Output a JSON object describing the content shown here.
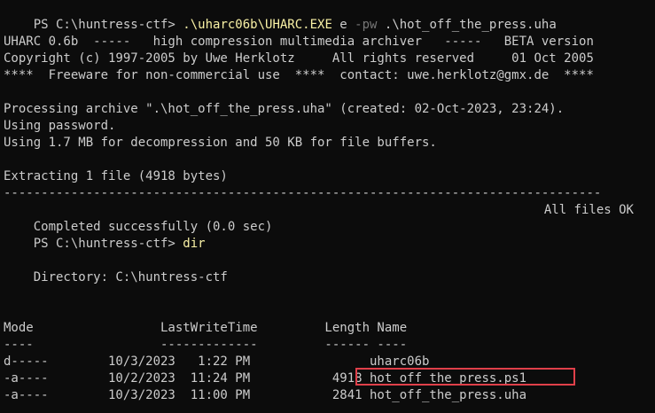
{
  "theme": {
    "background": "#0c0c0c",
    "foreground": "#cccccc",
    "command_color": "#f9f1a5",
    "parameter_color": "#767676",
    "highlight_border": "#e0404a"
  },
  "lines": {
    "prompt1": {
      "prompt": "PS C:\\huntress-ctf> ",
      "exe": ".\\uharc06b\\UHARC.EXE",
      "arg1": " e ",
      "flag": "-pw",
      "arg2": " .\\hot_off_the_press.uha"
    },
    "banner1": "UHARC 0.6b  -----   high compression multimedia archiver   -----   BETA version",
    "banner2": "Copyright (c) 1997-2005 by Uwe Herklotz     All rights reserved     01 Oct 2005",
    "banner3": "****  Freeware for non-commercial use  ****  contact: uwe.herklotz@gmx.de  ****",
    "processing": "Processing archive \".\\hot_off_the_press.uha\" (created: 02-Oct-2023, 23:24).",
    "using_password": "Using password.",
    "using_memory": "Using 1.7 MB for decompression and 50 KB for file buffers.",
    "extracting": "Extracting 1 file (4918 bytes)",
    "separator": "--------------------------------------------------------------------------------",
    "completed_left": "Completed successfully (0.0 sec)",
    "completed_right": "All files OK",
    "prompt2": {
      "prompt": "PS C:\\huntress-ctf> ",
      "command": "dir"
    },
    "directory": "    Directory: C:\\huntress-ctf",
    "header": "Mode                 LastWriteTime         Length Name",
    "header_underline": "----                 -------------         ------ ----",
    "rows": [
      "d-----        10/3/2023   1:22 PM                uharc06b",
      "-a----        10/2/2023  11:24 PM           4918 hot_off_the_press.ps1",
      "-a----        10/3/2023  11:00 PM           2841 hot_off_the_press.uha"
    ]
  }
}
